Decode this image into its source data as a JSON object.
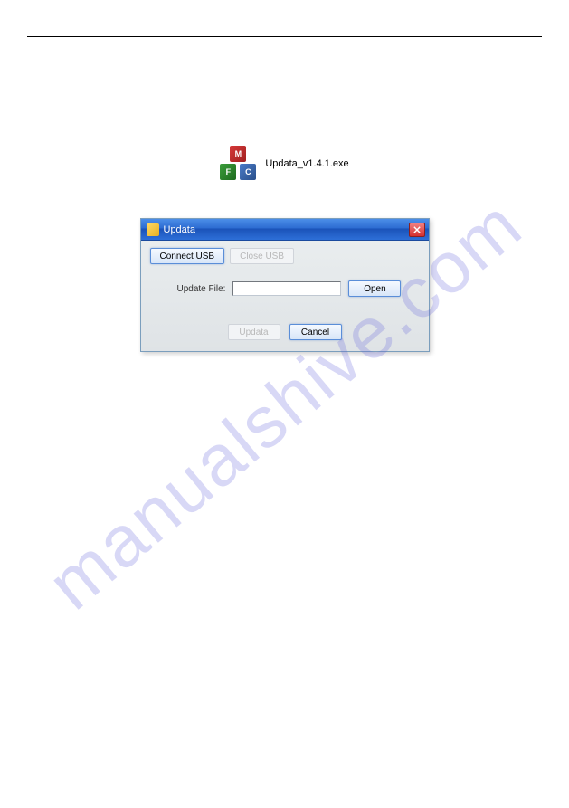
{
  "watermark": "manualshive.com",
  "exe": {
    "filename": "Updata_v1.4.1.exe",
    "icon_letters": {
      "m": "M",
      "f": "F",
      "c": "C"
    }
  },
  "dialog": {
    "title": "Updata",
    "buttons": {
      "connect_usb": "Connect USB",
      "close_usb": "Close USB",
      "open": "Open",
      "updata": "Updata",
      "cancel": "Cancel"
    },
    "labels": {
      "update_file": "Update File:"
    },
    "inputs": {
      "file_path": ""
    }
  }
}
